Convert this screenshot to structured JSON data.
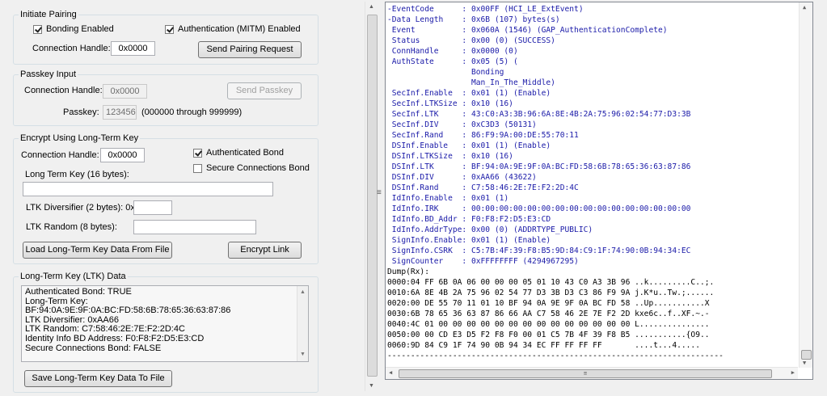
{
  "initiate_pairing": {
    "title": "Initiate Pairing",
    "bonding_label": "Bonding Enabled",
    "auth_label": "Authentication (MITM) Enabled",
    "conn_label": "Connection Handle:",
    "conn_value": "0x0000",
    "send_button": "Send Pairing Request"
  },
  "passkey_input": {
    "title": "Passkey Input",
    "conn_label": "Connection Handle:",
    "conn_value": "0x0000",
    "send_button": "Send Passkey",
    "passkey_label": "Passkey:",
    "passkey_value": "123456",
    "range_label": "(000000 through 999999)"
  },
  "encrypt": {
    "title": "Encrypt Using Long-Term Key",
    "conn_label": "Connection Handle:",
    "conn_value": "0x0000",
    "auth_bond_label": "Authenticated Bond",
    "sc_bond_label": "Secure Connections Bond",
    "ltk_label": "Long Term Key (16 bytes):",
    "ltk_value": "",
    "div_label": "LTK Diversifier (2 bytes): 0x",
    "div_value": "",
    "rand_label": "LTK Random (8 bytes):",
    "rand_value": "",
    "load_button": "Load Long-Term Key Data From File",
    "encrypt_button": "Encrypt Link"
  },
  "ltk_data": {
    "title": "Long-Term Key (LTK) Data",
    "lines": [
      "Authenticated Bond: TRUE",
      "Long-Term Key:",
      "BF:94:0A:9E:9F:0A:BC:FD:58:6B:78:65:36:63:87:86",
      "LTK Diversifier: 0xAA66",
      "LTK Random: C7:58:46:2E:7E:F2:2D:4C",
      "Identity Info BD Address: F0:F8:F2:D5:E3:CD",
      "Secure Connections Bond: FALSE"
    ],
    "save_button": "Save Long-Term Key Data To File"
  },
  "log": {
    "lines": [
      "-EventCode      : 0x00FF (HCI_LE_ExtEvent)",
      "-Data Length    : 0x6B (107) bytes(s)",
      " Event          : 0x060A (1546) (GAP_AuthenticationComplete)",
      " Status         : 0x00 (0) (SUCCESS)",
      " ConnHandle     : 0x0000 (0)",
      " AuthState      : 0x05 (5) (",
      "                  Bonding",
      "                  Man_In_The_Middle)",
      " SecInf.Enable  : 0x01 (1) (Enable)",
      " SecInf.LTKSize : 0x10 (16)",
      " SecInf.LTK     : 43:C0:A3:3B:96:6A:8E:4B:2A:75:96:02:54:77:D3:3B",
      " SecInf.DIV     : 0xC3D3 (50131)",
      " SecInf.Rand    : 86:F9:9A:00:DE:55:70:11",
      " DSInf.Enable   : 0x01 (1) (Enable)",
      " DSInf.LTKSize  : 0x10 (16)",
      " DSInf.LTK      : BF:94:0A:9E:9F:0A:BC:FD:58:6B:78:65:36:63:87:86",
      " DSInf.DIV      : 0xAA66 (43622)",
      " DSInf.Rand     : C7:58:46:2E:7E:F2:2D:4C",
      " IdInfo.Enable  : 0x01 (1)",
      " IdInfo.IRK     : 00:00:00:00:00:00:00:00:00:00:00:00:00:00:00:00",
      " IdInfo.BD_Addr : F0:F8:F2:D5:E3:CD",
      " IdInfo.AddrType: 0x00 (0) (ADDRTYPE_PUBLIC)",
      " SignInfo.Enable: 0x01 (1) (Enable)",
      " SignInfo.CSRK  : C5:7B:4F:39:F8:B5:9D:84:C9:1F:74:90:0B:94:34:EC",
      " SignCounter    : 0xFFFFFFFF (4294967295)"
    ],
    "dump": [
      "Dump(Rx):",
      "0000:04 FF 6B 0A 06 00 00 00 05 01 10 43 C0 A3 3B 96 ..k.........C..;.",
      "0010:6A 8E 4B 2A 75 96 02 54 77 D3 3B D3 C3 86 F9 9A j.K*u..Tw.;......",
      "0020:00 DE 55 70 11 01 10 BF 94 0A 9E 9F 0A BC FD 58 ..Up...........X",
      "0030:6B 78 65 36 63 87 86 66 AA C7 58 46 2E 7E F2 2D kxe6c..f..XF.~.-",
      "0040:4C 01 00 00 00 00 00 00 00 00 00 00 00 00 00 00 L...............",
      "0050:00 00 CD E3 D5 F2 F8 F0 00 01 C5 7B 4F 39 F8 B5 ...........{O9..",
      "0060:9D 84 C9 1F 74 90 0B 94 34 EC FF FF FF FF       ....t...4.....",
      "------------------------------------------------------------------------"
    ]
  },
  "splitter_glyph": "≡",
  "hscroll_glyph": "≡"
}
